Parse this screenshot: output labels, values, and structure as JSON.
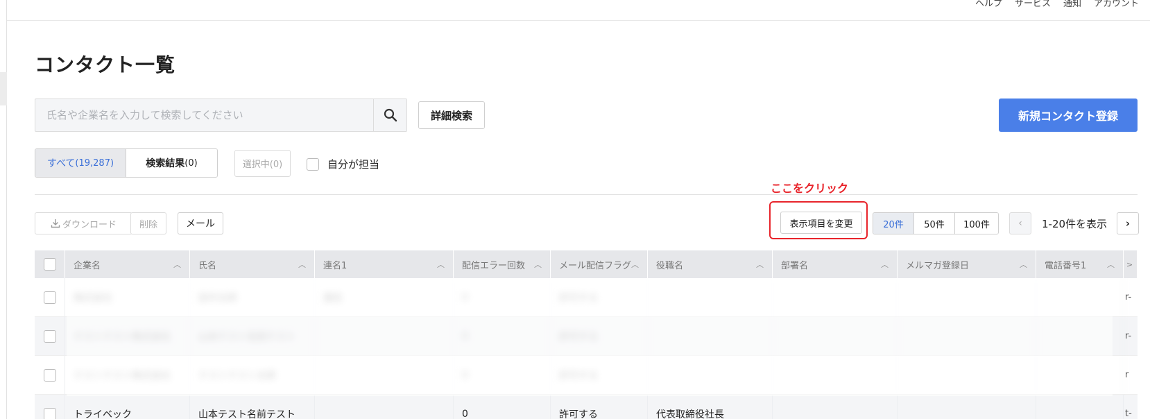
{
  "nav": {
    "items": [
      "ヘルプ",
      "サービス",
      "通知",
      "アカウント"
    ]
  },
  "page": {
    "title": "コンタクト一覧"
  },
  "search": {
    "placeholder": "氏名や企業名を入力して検索してください",
    "advanced_label": "詳細検索"
  },
  "actions": {
    "new_contact": "新規コンタクト登録"
  },
  "tabs": {
    "all_label": "すべて",
    "all_count": "(19,287)",
    "results_label": "検索結果",
    "results_count": "(0)",
    "selected": "選択中(0)",
    "own_checkbox": "自分が担当"
  },
  "toolbar": {
    "download": "ダウンロード",
    "delete": "削除",
    "mail": "メール",
    "change_columns": "表示項目を変更",
    "page_sizes": [
      "20件",
      "50件",
      "100件"
    ],
    "active_page_size": "20件",
    "range": "1-20件を表示",
    "prev": "‹",
    "next": "›"
  },
  "annotation": {
    "label": "ここをクリック"
  },
  "table": {
    "columns": [
      "企業名",
      "氏名",
      "連名1",
      "配信エラー回数",
      "メール配信フラグ",
      "役職名",
      "部署名",
      "メルマガ登録日",
      "電話番号1"
    ],
    "rows": [
      {
        "company": "株式会社",
        "name": "田中太郎",
        "renmei": "連名",
        "errors": "0",
        "flag": "許可する",
        "title": "",
        "dept": "",
        "date": "",
        "tel": "",
        "edge": "r-"
      },
      {
        "company": "テストテスト株式会社",
        "name": "山本テスト名前テスト",
        "renmei": "",
        "errors": "0",
        "flag": "許可する",
        "title": "",
        "dept": "",
        "date": "",
        "tel": "",
        "edge": "r-"
      },
      {
        "company": "テストテスト株式会社",
        "name": "テストテスト太郎",
        "renmei": "",
        "errors": "0",
        "flag": "許可する",
        "title": "",
        "dept": "",
        "date": "",
        "tel": "",
        "edge": "r"
      },
      {
        "company": "トライベック",
        "name": "山本テスト名前テスト",
        "renmei": "",
        "errors": "0",
        "flag": "許可する",
        "title": "代表取締役社長",
        "dept": "",
        "date": "",
        "tel": "",
        "edge": "t-"
      }
    ]
  }
}
